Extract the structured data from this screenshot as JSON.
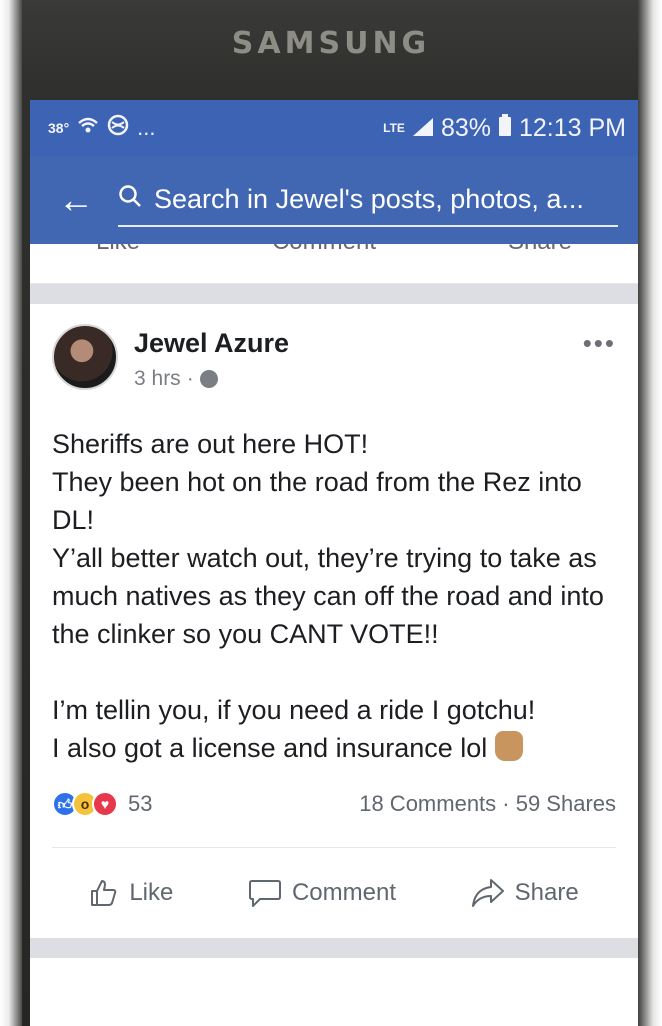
{
  "device": {
    "brand": "SAMSUNG"
  },
  "status_bar": {
    "temperature": "38°",
    "ellipsis": "...",
    "network": "LTE",
    "battery": "83%",
    "time": "12:13 PM"
  },
  "search": {
    "placeholder": "Search in Jewel's posts, photos, a..."
  },
  "previous_post_actions": [
    "Like",
    "Comment",
    "Share"
  ],
  "post": {
    "author": "Jewel Azure",
    "time": "3 hrs",
    "separator": "·",
    "paragraphs": [
      "Sheriffs are out here HOT!\nThey been hot on the road from the Rez into DL!\nY’all better watch out, they’re trying to take as much natives as they can off the road and into the clinker so you CANT VOTE!!",
      "I’m tellin you, if you need a ride I gotchu!\nI also got a license and insurance lol"
    ],
    "reaction_count": "53",
    "comments_shares": "18 Comments · 59 Shares",
    "actions": {
      "like": "Like",
      "comment": "Comment",
      "share": "Share"
    }
  }
}
